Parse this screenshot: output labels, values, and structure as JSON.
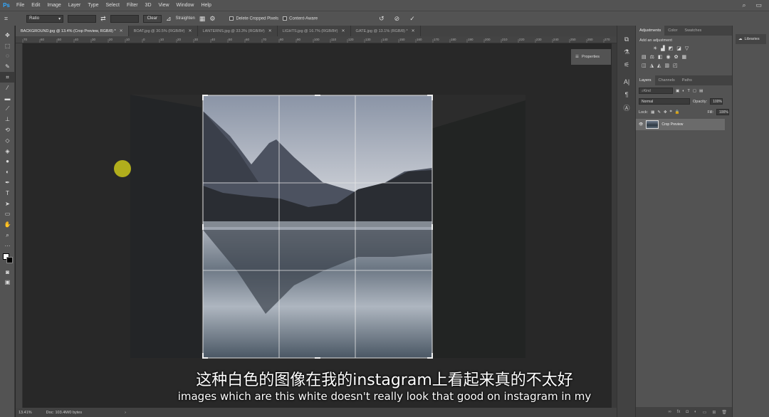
{
  "app": {
    "logo": "Ps"
  },
  "menu": [
    "File",
    "Edit",
    "Image",
    "Layer",
    "Type",
    "Select",
    "Filter",
    "3D",
    "View",
    "Window",
    "Help"
  ],
  "options": {
    "ratio_label": "Ratio",
    "swap_icon": "swap-arrows-icon",
    "clear_label": "Clear",
    "straighten_label": "Straighten",
    "delete_cropped_label": "Delete Cropped Pixels",
    "content_aware_label": "Content-Aware",
    "reset_icon": "undo-icon",
    "cancel_icon": "cancel-icon",
    "commit_icon": "checkmark-icon"
  },
  "tabs": [
    {
      "label": "BACKGROUND.jpg @ 13.4% (Crop Preview, RGB/8) *",
      "active": true
    },
    {
      "label": "BOAT.jpg @ 30.5% (RGB/8#)",
      "active": false
    },
    {
      "label": "LANTERNS.jpg @ 33.3% (RGB/8#)",
      "active": false
    },
    {
      "label": "LIGHTS.jpg @ 16.7% (RGB/8#)",
      "active": false
    },
    {
      "label": "GATE.jpg @ 13.1% (RGB/8) *",
      "active": false
    }
  ],
  "ruler_ticks": [
    "70",
    "60",
    "50",
    "40",
    "30",
    "20",
    "10",
    "0",
    "10",
    "20",
    "30",
    "40",
    "50",
    "60",
    "70",
    "80",
    "90",
    "100",
    "110",
    "120",
    "130",
    "140",
    "150",
    "160",
    "170",
    "180",
    "190",
    "200",
    "210",
    "220",
    "230",
    "240",
    "250",
    "260",
    "270",
    "280",
    "290",
    "300"
  ],
  "properties_label": "Properties",
  "status": {
    "zoom": "13.41%",
    "doc": "Doc: 103.4M/0 bytes"
  },
  "panels": {
    "adj_tabs": [
      "Adjustments",
      "Color",
      "Swatches"
    ],
    "adj_title": "Add an adjustment",
    "layer_tabs": [
      "Layers",
      "Channels",
      "Paths"
    ],
    "kind_placeholder": "Kind",
    "blend_mode": "Normal",
    "opacity_label": "Opacity:",
    "opacity_value": "100%",
    "lock_label": "Lock:",
    "fill_label": "Fill:",
    "fill_value": "100%",
    "layer_name": "Crop Preview"
  },
  "libraries_label": "Libraries",
  "subtitles": {
    "cn": "这种白色的图像在我的instagram上看起来真的不太好",
    "en": "images which are this white doesn't really look that good on instagram in my"
  }
}
